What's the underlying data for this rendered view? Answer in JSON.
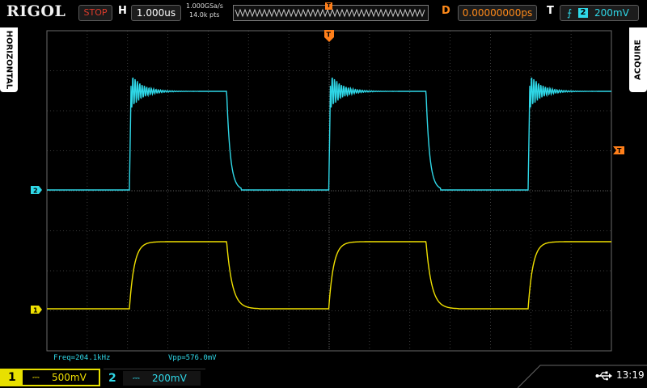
{
  "topbar": {
    "brand": "RIGOL",
    "run_status": "STOP",
    "h_label": "H",
    "timebase": "1.000us",
    "sample_rate": "1.000GSa/s",
    "memory_depth": "14.0k pts",
    "trig_marker": "T",
    "d_label": "D",
    "delay": "0.00000000ps",
    "t_label": "T",
    "trigger_edge": "rising-edge-icon",
    "trigger_source": "2",
    "trigger_level": "200mV"
  },
  "side_tabs": {
    "left": "HORIZONTAL",
    "right": "ACQUIRE"
  },
  "markers": {
    "ch1": "1",
    "ch2": "2",
    "trig_top": "T",
    "trig_level": "T"
  },
  "measurements": {
    "freq": "Freq=204.1kHz",
    "vpp": "Vpp=576.0mV"
  },
  "bottombar": {
    "ch1_num": "1",
    "ch1_scale": "500mV",
    "ch2_num": "2",
    "ch2_scale": "200mV",
    "clock": "13:19"
  },
  "colors": {
    "ch1": "#f0e000",
    "ch2": "#2fd8e8",
    "trigger": "#ff7f1a",
    "grid": "#4a4a4a"
  }
}
